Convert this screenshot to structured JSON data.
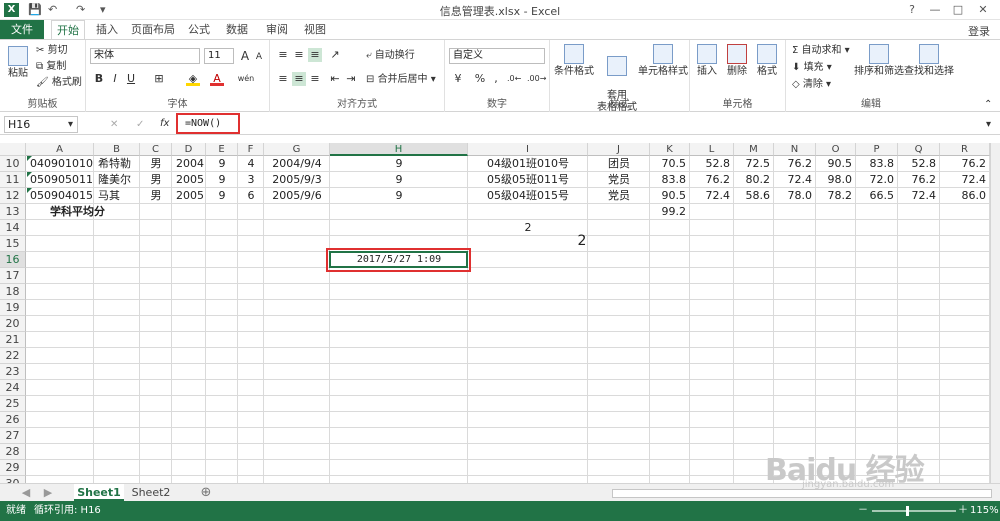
{
  "window": {
    "title": "信息管理表.xlsx - Excel",
    "help": "?",
    "minimize": "—",
    "maximize": "□",
    "close": "✕"
  },
  "ribbon_tabs": [
    "文件",
    "开始",
    "插入",
    "页面布局",
    "公式",
    "数据",
    "审阅",
    "视图"
  ],
  "login": "登录",
  "clipboard": {
    "paste": "粘贴",
    "cut": "剪切",
    "copy": "复制",
    "painter": "格式刷",
    "label": "剪贴板"
  },
  "font": {
    "name": "宋体",
    "size": "11",
    "label": "字体",
    "bold": "B",
    "italic": "I",
    "underline": "U",
    "grow": "A",
    "shrink": "A",
    "fill_letter": "A",
    "wen": "wén"
  },
  "alignment": {
    "wrap": "自动换行",
    "merge": "合并后居中",
    "label": "对齐方式"
  },
  "number": {
    "format": "自定义",
    "percent": "%",
    "comma": ",",
    "label": "数字"
  },
  "styles": {
    "conditional": "条件格式",
    "table": "套用\n表格格式",
    "cell": "单元格样式",
    "label": "样式"
  },
  "cells": {
    "insert": "插入",
    "delete": "删除",
    "format": "格式",
    "label": "单元格"
  },
  "editing": {
    "autosum": "自动求和",
    "fill": "填充",
    "clear": "清除",
    "sort": "排序和筛选",
    "find": "查找和选择",
    "label": "编辑"
  },
  "formula_bar": {
    "name_box": "H16",
    "fx": "fx",
    "formula": "=NOW()"
  },
  "columns": [
    "A",
    "B",
    "C",
    "D",
    "E",
    "F",
    "G",
    "H",
    "I",
    "J",
    "K",
    "L",
    "M",
    "N",
    "O",
    "P",
    "Q",
    "R"
  ],
  "rows": [
    {
      "num": "10",
      "cells": [
        "040901010",
        "希特勒",
        "男",
        "2004",
        "9",
        "4",
        "2004/9/4",
        "9",
        "04级01班010号",
        "团员",
        "70.5",
        "52.8",
        "72.5",
        "76.2",
        "90.5",
        "83.8",
        "52.8",
        "76.2"
      ]
    },
    {
      "num": "11",
      "cells": [
        "050905011",
        "隆美尔",
        "男",
        "2005",
        "9",
        "3",
        "2005/9/3",
        "9",
        "05级05班011号",
        "党员",
        "83.8",
        "76.2",
        "80.2",
        "72.4",
        "98.0",
        "72.0",
        "76.2",
        "72.4"
      ]
    },
    {
      "num": "12",
      "cells": [
        "050904015",
        "马其",
        "男",
        "2005",
        "9",
        "6",
        "2005/9/6",
        "9",
        "05级04班015号",
        "党员",
        "90.5",
        "72.4",
        "58.6",
        "78.0",
        "78.2",
        "66.5",
        "72.4",
        "86.0"
      ]
    },
    {
      "num": "13",
      "cells": [
        "",
        "学科平均分",
        "",
        "",
        "",
        "",
        "",
        "",
        "",
        "",
        "99.2",
        "",
        "",
        "",
        "",
        "",
        "",
        ""
      ]
    },
    {
      "num": "14",
      "cells": [
        "",
        "",
        "",
        "",
        "",
        "",
        "",
        "",
        "2",
        "",
        "",
        "",
        "",
        "",
        "",
        "",
        "",
        ""
      ]
    },
    {
      "num": "15",
      "cells": [
        "",
        "",
        "",
        "",
        "",
        "",
        "",
        "",
        "",
        "",
        "",
        "",
        "",
        "",
        "",
        "",
        "",
        ""
      ]
    },
    {
      "num": "16",
      "cells": [
        "",
        "",
        "",
        "",
        "",
        "",
        "",
        "2017/5/27  1:09",
        "",
        "",
        "",
        "",
        "",
        "",
        "",
        "",
        "",
        ""
      ]
    },
    {
      "num": "17",
      "cells": []
    },
    {
      "num": "18",
      "cells": []
    },
    {
      "num": "19",
      "cells": []
    },
    {
      "num": "20",
      "cells": []
    },
    {
      "num": "21",
      "cells": []
    },
    {
      "num": "22",
      "cells": []
    },
    {
      "num": "23",
      "cells": []
    },
    {
      "num": "24",
      "cells": []
    },
    {
      "num": "25",
      "cells": []
    },
    {
      "num": "26",
      "cells": []
    },
    {
      "num": "27",
      "cells": []
    },
    {
      "num": "28",
      "cells": []
    },
    {
      "num": "29",
      "cells": []
    },
    {
      "num": "30",
      "cells": []
    },
    {
      "num": "31",
      "cells": []
    }
  ],
  "floating_value": "2",
  "sheets": [
    "Sheet1",
    "Sheet2"
  ],
  "add_sheet": "⊕",
  "sheet_nav": {
    "prev": "◀",
    "next": "▶"
  },
  "status": {
    "ready": "就绪",
    "circular": "循环引用: H16",
    "zoom": "115%",
    "minus": "－",
    "plus": "＋"
  },
  "watermark": {
    "brand": "Baidu 经验",
    "url": "jingyan.baidu.com"
  },
  "colors": {
    "excel_green": "#217346",
    "highlight_red": "#e03030"
  }
}
